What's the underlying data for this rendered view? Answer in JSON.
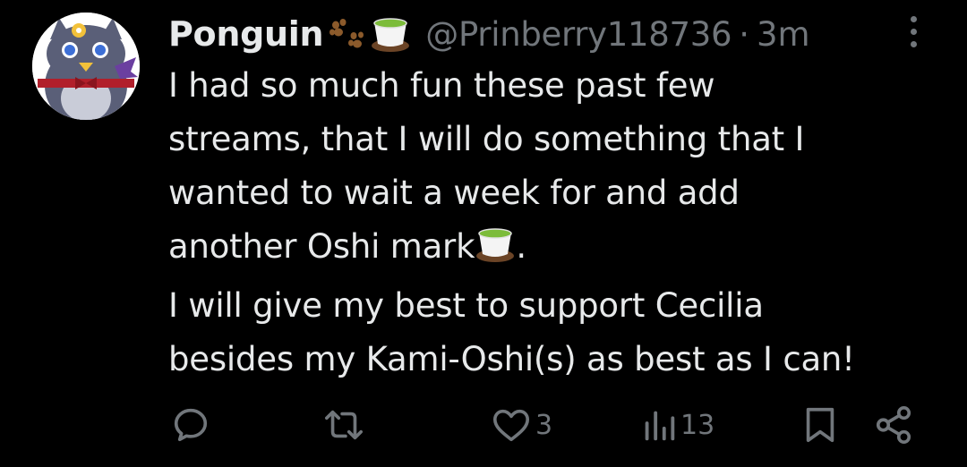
{
  "tweet": {
    "display_name": "Ponguin",
    "name_emojis": [
      "paw-prints-emoji",
      "green-tea-emoji"
    ],
    "handle": "@Prinberry118736",
    "separator": "·",
    "time": "3m",
    "body_lines": [
      "I had so much fun these past few",
      "streams, that I will do something that I",
      "wanted to wait a week for and add",
      "another Oshi mark",
      "I will give my best to support Cecilia",
      "besides my Kami-Oshi(s) as best as I can!"
    ],
    "body_line4_suffix": ".",
    "inline_emoji": "green-tea-emoji"
  },
  "actions": {
    "reply_icon": "reply-icon",
    "retweet_icon": "retweet-icon",
    "like_icon": "heart-icon",
    "like_count": "3",
    "views_icon": "views-chart-icon",
    "views_count": "13",
    "bookmark_icon": "bookmark-icon",
    "share_icon": "share-icon"
  },
  "colors": {
    "background": "#000000",
    "primary_text": "#e7e9ea",
    "secondary_text": "#71767b"
  }
}
